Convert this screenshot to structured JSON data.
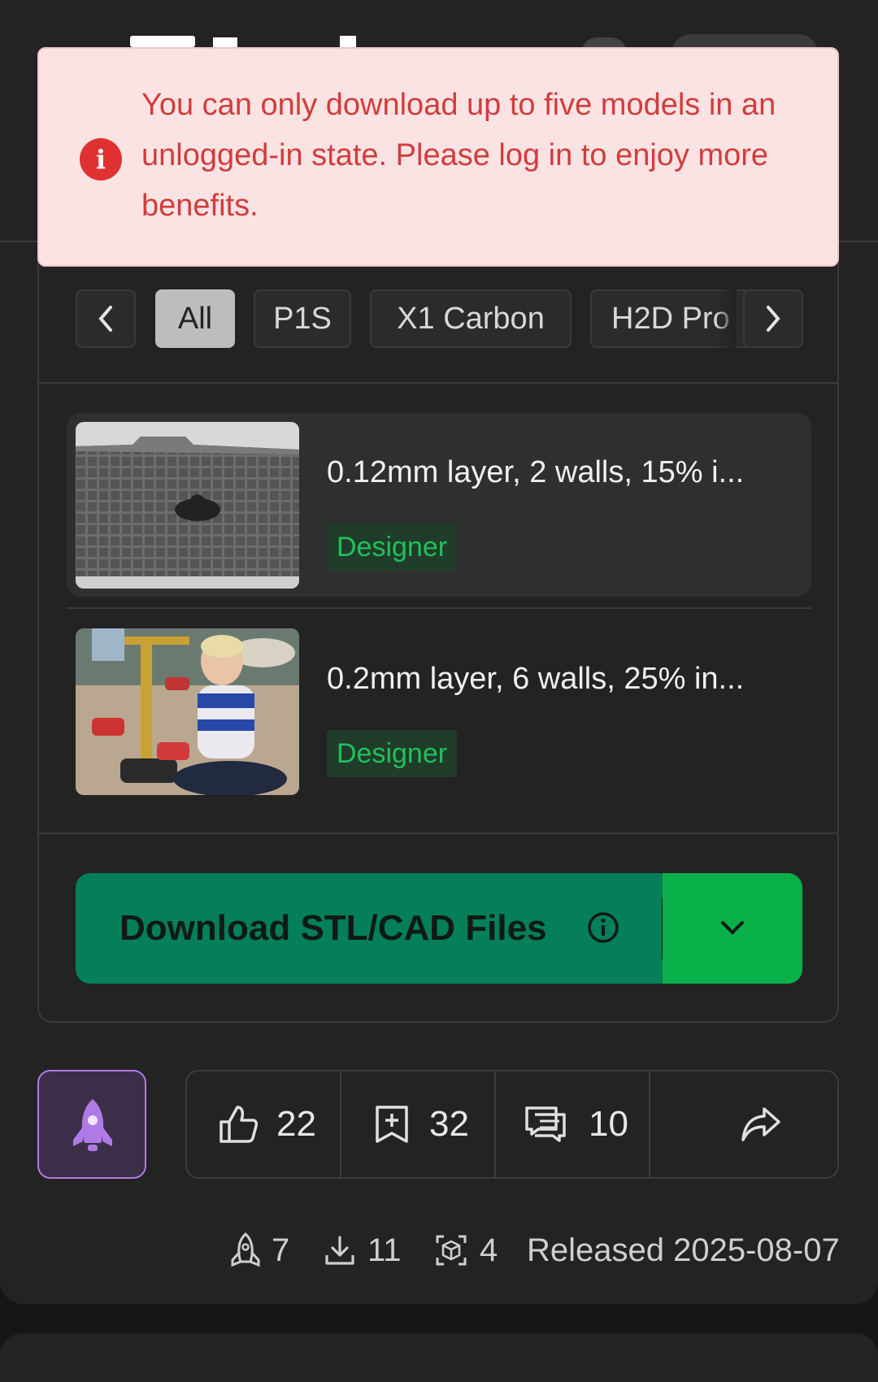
{
  "toast": {
    "message": "You can only download up to five models in an unlogged-in state. Please log in to enjoy more benefits.",
    "icon": "error-icon",
    "color": "#d23c3c",
    "background": "#fbe3e3"
  },
  "printer_tabs": {
    "prev_icon": "chevron-left-icon",
    "next_icon": "chevron-right-icon",
    "items": [
      "All",
      "P1S",
      "X1 Carbon",
      "H2D Pro"
    ],
    "selected": "All"
  },
  "profiles": [
    {
      "title": "0.12mm layer, 2 walls, 15% i...",
      "badge": "Designer",
      "selected": true
    },
    {
      "title": "0.2mm layer, 6 walls, 25% in...",
      "badge": "Designer",
      "selected": false
    }
  ],
  "download": {
    "label": "Download STL/CAD Files",
    "info_icon": "info-icon",
    "dropdown_icon": "chevron-down-icon",
    "color": "#047f5a",
    "accent": "#09b04a"
  },
  "actions": {
    "boost_icon": "rocket-icon",
    "like_count": "22",
    "collect_count": "32",
    "comment_count": "10",
    "share_icon": "share-icon"
  },
  "footer": {
    "boosts": "7",
    "downloads": "11",
    "prints": "4",
    "released": "Released 2025-08-07"
  },
  "badge_color": "#22c05a"
}
